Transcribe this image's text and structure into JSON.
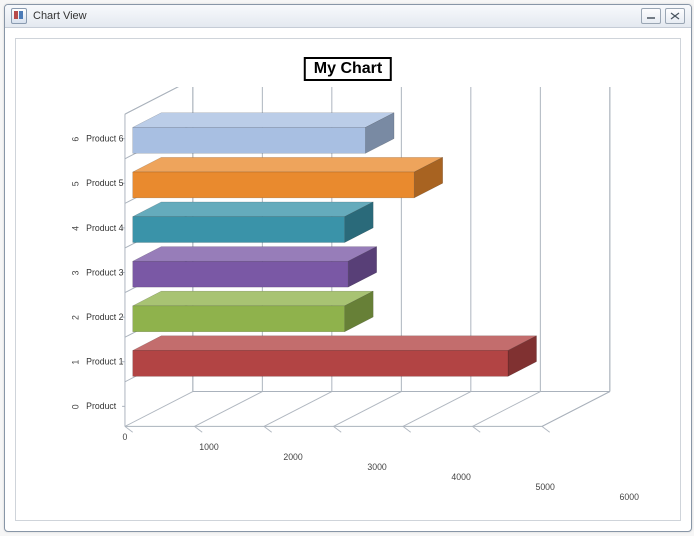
{
  "window": {
    "title": "Chart View"
  },
  "chart": {
    "title": "My Chart"
  },
  "chart_data": {
    "type": "bar",
    "orientation": "horizontal-3d",
    "title": "My Chart",
    "xlabel": "",
    "ylabel": "",
    "xlim": [
      0,
      6000
    ],
    "x_ticks": [
      0,
      1000,
      2000,
      3000,
      4000,
      5000,
      6000
    ],
    "categories": [
      "Product",
      "Product 1",
      "Product 2",
      "Product 3",
      "Product 4",
      "Product 5",
      "Product 6"
    ],
    "category_indices": [
      0,
      1,
      2,
      3,
      4,
      5,
      6
    ],
    "values": [
      null,
      5400,
      3050,
      3100,
      3050,
      4050,
      3350
    ],
    "colors": {
      "Product 1": "#b24444",
      "Product 2": "#8fb24c",
      "Product 3": "#7a58a5",
      "Product 4": "#3a93a9",
      "Product 5": "#e98a2e",
      "Product 6": "#a8bfe2"
    }
  }
}
